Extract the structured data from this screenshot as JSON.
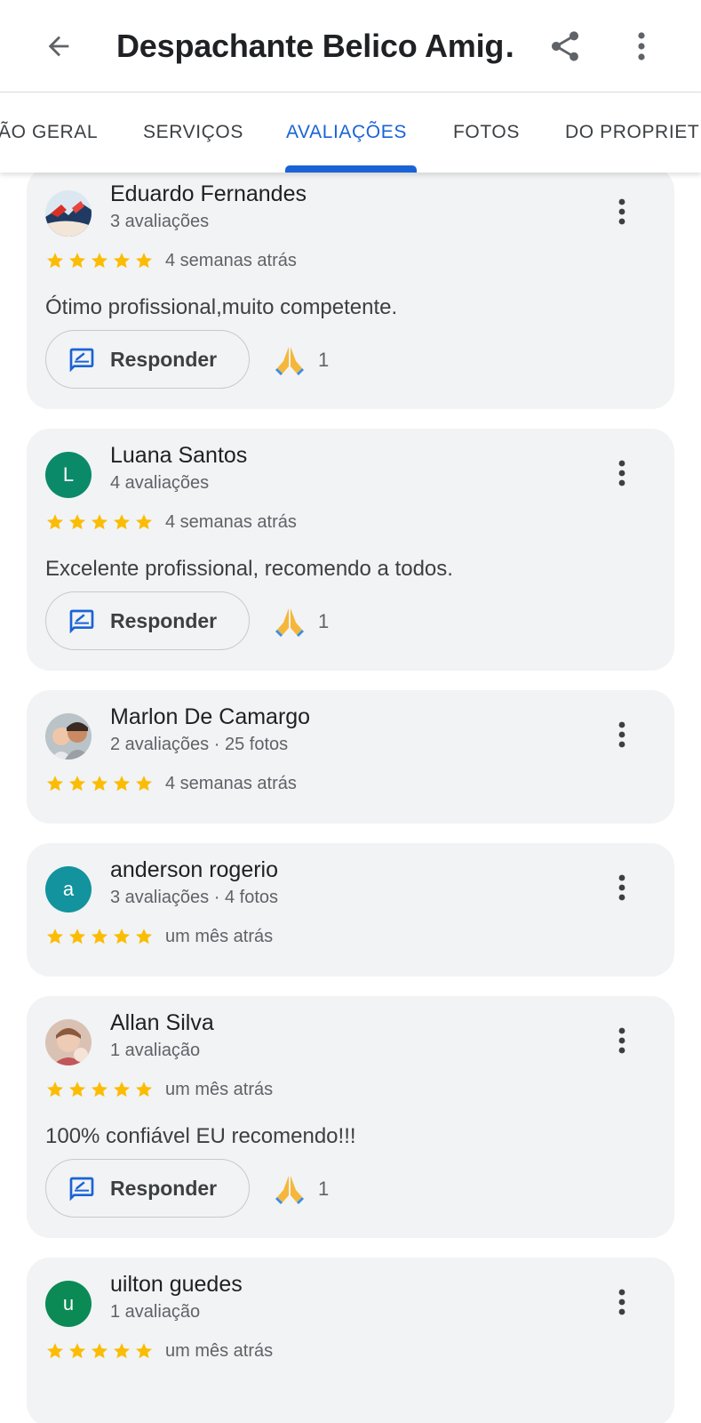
{
  "header": {
    "title": "Despachante Belico Amig…",
    "back_icon": "arrow-back-icon",
    "share_icon": "share-icon",
    "more_icon": "more-vert-icon"
  },
  "tabs": [
    {
      "label": "ÃO GERAL",
      "active": false
    },
    {
      "label": "SERVIÇOS",
      "active": false
    },
    {
      "label": "AVALIAÇÕES",
      "active": true
    },
    {
      "label": "FOTOS",
      "active": false
    },
    {
      "label": "DO PROPRIET",
      "active": false
    }
  ],
  "colors": {
    "accent": "#1a63d6",
    "star": "#fbbc04",
    "card_bg": "#f1f3f4"
  },
  "reviews": [
    {
      "name": "Eduardo Fernandes",
      "meta": "3 avaliações",
      "rating": 5,
      "time": "4 semanas atrás",
      "text": "Ótimo profissional,muito competente.",
      "reply_label": "Responder",
      "reaction_icon": "folded-hands-emoji",
      "reaction_count": "1",
      "avatar": {
        "type": "photo"
      }
    },
    {
      "name": "Luana Santos",
      "meta": "4 avaliações",
      "rating": 5,
      "time": "4 semanas atrás",
      "text": "Excelente profissional, recomendo a todos.",
      "reply_label": "Responder",
      "reaction_icon": "folded-hands-emoji",
      "reaction_count": "1",
      "avatar": {
        "type": "letter",
        "letter": "L",
        "color": "#0b8a6a"
      }
    },
    {
      "name": "Marlon De Camargo",
      "meta": "2 avaliações · 25 fotos",
      "rating": 5,
      "time": "4 semanas atrás",
      "avatar": {
        "type": "photo"
      }
    },
    {
      "name": "anderson rogerio",
      "meta": "3 avaliações · 4 fotos",
      "rating": 5,
      "time": "um mês atrás",
      "avatar": {
        "type": "letter",
        "letter": "a",
        "color": "#12939e"
      }
    },
    {
      "name": "Allan Silva",
      "meta": "1 avaliação",
      "rating": 5,
      "time": "um mês atrás",
      "text": "100% confiável EU recomendo!!!",
      "reply_label": "Responder",
      "reaction_icon": "folded-hands-emoji",
      "reaction_count": "1",
      "avatar": {
        "type": "photo"
      }
    },
    {
      "name": "uilton guedes",
      "meta": "1 avaliação",
      "rating": 5,
      "time": "um mês atrás",
      "avatar": {
        "type": "letter",
        "letter": "u",
        "color": "#0b8a56"
      }
    }
  ]
}
